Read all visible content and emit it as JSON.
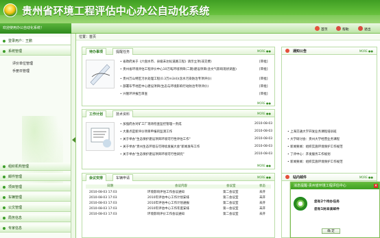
{
  "app": {
    "title": "贵州省环境工程评估中心办公自动化系统"
  },
  "menu": {
    "welcome": "欢迎使用办公自动化系统！",
    "buttons": [
      {
        "label": "首页",
        "color": "#e5533d"
      },
      {
        "label": "帮助",
        "color": "#d94b41"
      },
      {
        "label": "退出",
        "color": "#d94b41"
      }
    ]
  },
  "sidebar": {
    "user_label": "登录用户：王鹏",
    "items": [
      "系统管理",
      "评价单位管理",
      "手册日管理",
      "组织机构管理",
      "邮件管理",
      "项目管理",
      "车辆管理",
      "公文管理",
      "局务信息",
      "专家信息"
    ]
  },
  "breadcrumb": "位置：首页",
  "panels": {
    "notice": {
      "tabs": [
        "待办事项",
        "提醒任务"
      ],
      "items": [
        {
          "text": "省政府关于《六盘水市、县级未达标道路工程》请示立项(非交费)",
          "status": "[审批]"
        },
        {
          "text": "贵州省环境评估工程评价中心10万吨环境项目(二期)建设项目(含文气影响现状调查)",
          "status": "[审批]"
        },
        {
          "text": "贵州万山特区污水处理工程(0.3万m3/d)(含水污染防治专项评价)",
          "status": "[审批]"
        },
        {
          "text": "部署毕节地区中心建设项目(生态与环境影响行动防治专项评价)",
          "status": "[审批]"
        },
        {
          "text": "兴隆环评报告审查",
          "status": "[审批]"
        }
      ]
    },
    "plan": {
      "tabs": [
        "工作计划",
        "技术资料"
      ],
      "items": [
        {
          "text": "加强府办对矿工厂现场检查监控管理一责成",
          "date": "2010-08-03"
        },
        {
          "text": "大重点是新评价项目申报的监测工作",
          "date": "2010-08-03"
        },
        {
          "text": "关于举办\"生态保护建设项目环境可行性评估工作\"",
          "date": "2010-08-03"
        },
        {
          "text": "关于举办\"贵州生态环境与可持续发展大会\"新闻发布工作",
          "date": "2010-08-03"
        },
        {
          "text": "关于举办\"生态保护建设项目环境可行性研究\"",
          "date": "2010-08-03"
        }
      ]
    },
    "meeting": {
      "tabs": [
        "会议安排",
        "车辆申请"
      ],
      "headers": [
        "日期",
        "会议内容",
        "会议室",
        "状态"
      ],
      "rows": [
        [
          "2010-08-03 17:03",
          "环境影响评估工作会议通知",
          "第二会议室",
          "未开"
        ],
        [
          "2010-08-03 17:03",
          "2010年评估中心工作计划安排",
          "第二会议室",
          "未开"
        ],
        [
          "2010-08-03 17:03",
          "2010年评估中心工作计划通报",
          "第二会议室",
          "未开"
        ],
        [
          "2010-08-03 17:03",
          "2010年评估中心工作年度安排",
          "第一会议室",
          "未开"
        ],
        [
          "2010-08-03 17:03",
          "环境影响评价工作会议通知",
          "第二会议室",
          "未开"
        ]
      ]
    },
    "bulletin": {
      "title": "通知公告",
      "items": [
        "上海交通大学开发业务课程培训班",
        "大学研讨会：贵州大学经营业务课程",
        "新闻要闻：组织实施环境保护工作规范",
        "了评中心：开发服务工作规划",
        "新闻要闻：组织实施环境保护工作规范"
      ]
    },
    "mail": {
      "title": "站内邮件"
    }
  },
  "popup": {
    "title": "消息提醒-贵州省环境工程评估中心",
    "task_line": "您有2个待办任务",
    "mail_line": "您有1封未读邮件",
    "button": "确 定",
    "close": "×"
  }
}
